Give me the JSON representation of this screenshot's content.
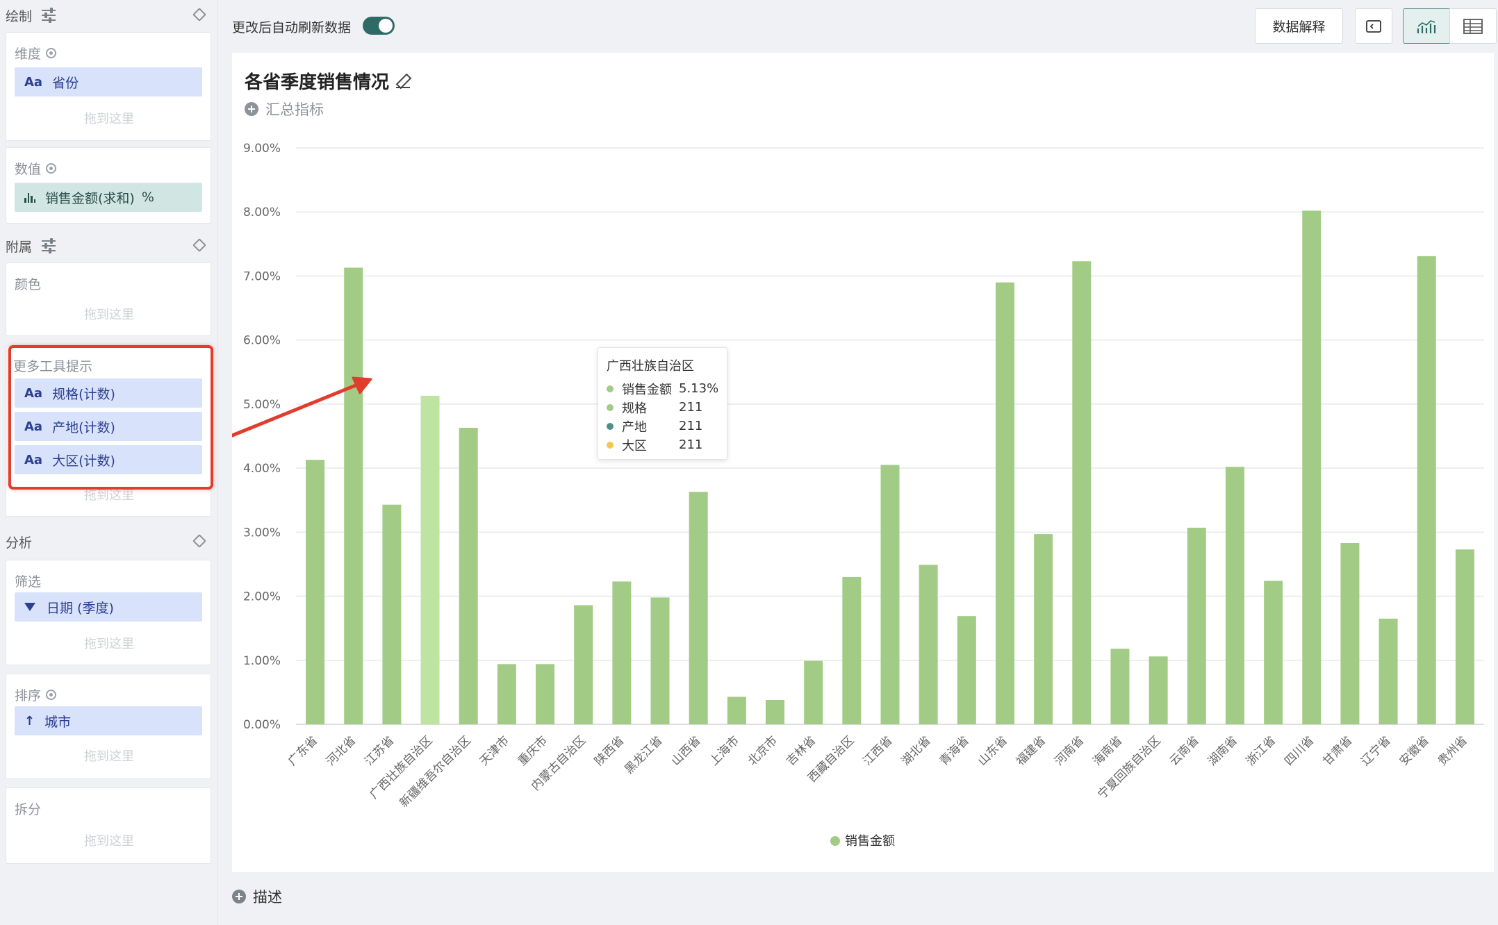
{
  "sidebar": {
    "draw": {
      "label": "绘制"
    },
    "dimension": {
      "label": "维度",
      "field": "省份",
      "drop": "拖到这里"
    },
    "value": {
      "label": "数值",
      "field": "销售金额(求和)",
      "suffix": "%"
    },
    "attach": {
      "label": "附属"
    },
    "color": {
      "label": "颜色",
      "drop": "拖到这里"
    },
    "tooltip": {
      "label": "更多工具提示",
      "fields": [
        "规格(计数)",
        "产地(计数)",
        "大区(计数)"
      ],
      "drop": "拖到这里"
    },
    "analysis": {
      "label": "分析"
    },
    "filter": {
      "label": "筛选",
      "field": "日期 (季度)",
      "drop": "拖到这里"
    },
    "sort": {
      "label": "排序",
      "field": "城市",
      "drop": "拖到这里"
    },
    "split": {
      "label": "拆分",
      "drop": "拖到这里"
    }
  },
  "toolbar": {
    "auto_refresh": "更改后自动刷新数据",
    "auto_refresh_on": true,
    "explain": "数据解释"
  },
  "panel": {
    "title": "各省季度销售情况",
    "add_metric": "汇总指标",
    "description": "描述"
  },
  "chart_data": {
    "type": "bar",
    "categories": [
      "广东省",
      "河北省",
      "江苏省",
      "广西壮族自治区",
      "新疆维吾尔自治区",
      "天津市",
      "重庆市",
      "内蒙古自治区",
      "陕西省",
      "黑龙江省",
      "山西省",
      "上海市",
      "北京市",
      "吉林省",
      "西藏自治区",
      "江西省",
      "湖北省",
      "青海省",
      "山东省",
      "福建省",
      "河南省",
      "海南省",
      "宁夏回族自治区",
      "云南省",
      "湖南省",
      "浙江省",
      "四川省",
      "甘肃省",
      "辽宁省",
      "安徽省",
      "贵州省"
    ],
    "series": [
      {
        "name": "销售金额",
        "values": [
          4.13,
          7.13,
          3.43,
          5.13,
          4.63,
          0.94,
          0.94,
          1.86,
          2.23,
          1.98,
          3.63,
          0.43,
          0.38,
          0.99,
          2.3,
          4.05,
          2.49,
          1.69,
          6.9,
          2.97,
          7.23,
          1.18,
          1.06,
          3.07,
          4.02,
          2.24,
          8.02,
          2.83,
          1.65,
          7.31,
          2.73
        ]
      }
    ],
    "ylim": [
      0,
      9
    ],
    "yticks": [
      "0.00%",
      "1.00%",
      "2.00%",
      "3.00%",
      "4.00%",
      "5.00%",
      "6.00%",
      "7.00%",
      "8.00%",
      "9.00%"
    ],
    "highlight_index": 3,
    "grid": true,
    "legend": "bottom-center",
    "colors": {
      "bar": "#a2cc85",
      "highlight": "#bfe4a1",
      "grid": "#e6e8eb",
      "axis_text": "#666666"
    }
  },
  "tooltip": {
    "title": "广西壮族自治区",
    "rows": [
      {
        "name": "销售金额",
        "value": "5.13%",
        "color": "#a2cc85"
      },
      {
        "name": "规格",
        "value": "211",
        "color": "#a2cc85"
      },
      {
        "name": "产地",
        "value": "211",
        "color": "#4e8f8b"
      },
      {
        "name": "大区",
        "value": "211",
        "color": "#f2c94c"
      }
    ]
  },
  "icons": {
    "chart_view": "bar-line-chart-icon",
    "table_view": "table-icon",
    "code": "code-icon"
  }
}
